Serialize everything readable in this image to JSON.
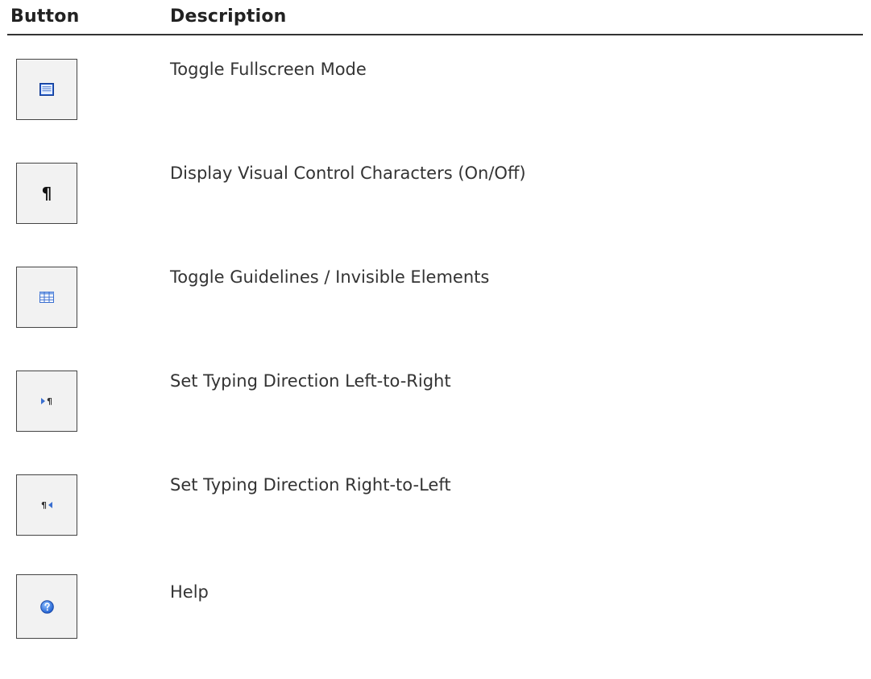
{
  "header": {
    "col_button": "Button",
    "col_description": "Description"
  },
  "rows": [
    {
      "icon": "fullscreen-icon",
      "description": "Toggle Fullscreen Mode"
    },
    {
      "icon": "pilcrow-icon",
      "description": "Display Visual Control Characters (On/Off)"
    },
    {
      "icon": "table-grid-icon",
      "description": "Toggle Guidelines / Invisible Elements"
    },
    {
      "icon": "ltr-direction-icon",
      "description": "Set Typing Direction Left-to-Right"
    },
    {
      "icon": "rtl-direction-icon",
      "description": "Set Typing Direction Right-to-Left"
    },
    {
      "icon": "help-icon",
      "description": "Help"
    }
  ],
  "colors": {
    "rule": "#333333",
    "button_bg": "#f2f2f2",
    "icon_blue": "#3a6fd0"
  }
}
